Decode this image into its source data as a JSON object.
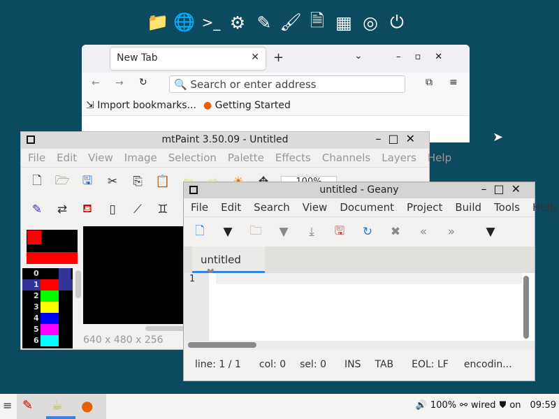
{
  "dock": {
    "icons": [
      "folder-icon",
      "globe-icon",
      "terminal-icon",
      "gears-icon",
      "edit-icon",
      "brush-icon",
      "document-icon",
      "table-icon",
      "lifebuoy-icon",
      "power-icon"
    ],
    "terminal_label": ">_"
  },
  "firefox": {
    "tab_title": "New Tab",
    "search_placeholder": "Search or enter address",
    "bookmarks": [
      "Import bookmarks...",
      "Getting Started"
    ]
  },
  "mtpaint": {
    "title": "mtPaint 3.50.09 - Untitled",
    "menu": [
      "File",
      "Edit",
      "View",
      "Image",
      "Selection",
      "Palette",
      "Effects",
      "Channels",
      "Layers",
      "Help"
    ],
    "zoom": "100%",
    "status": "640 x 480 x 256",
    "palette": [
      {
        "index": "0",
        "color": "#000000"
      },
      {
        "index": "1",
        "color": "#ff0000"
      },
      {
        "index": "2",
        "color": "#00ff00"
      },
      {
        "index": "3",
        "color": "#ffff00"
      },
      {
        "index": "4",
        "color": "#0000ff"
      },
      {
        "index": "5",
        "color": "#ff00ff"
      },
      {
        "index": "6",
        "color": "#00ffff"
      }
    ]
  },
  "geany": {
    "title": "untitled - Geany",
    "menu": [
      "File",
      "Edit",
      "Search",
      "View",
      "Document",
      "Project",
      "Build",
      "Tools",
      "Help"
    ],
    "tab": "untitled",
    "line_number": "1",
    "status": {
      "line": "line: 1 / 1",
      "col": "col: 0",
      "sel": "sel: 0",
      "mode": "INS",
      "indent": "TAB",
      "eol": "EOL: LF",
      "encoding": "encodin..."
    }
  },
  "taskbar": {
    "volume": "100%",
    "network": "wired",
    "vpn": "on",
    "clock": "09:59"
  },
  "colors": {
    "desktop": "#0c4a5f",
    "accent": "#3584e4"
  }
}
